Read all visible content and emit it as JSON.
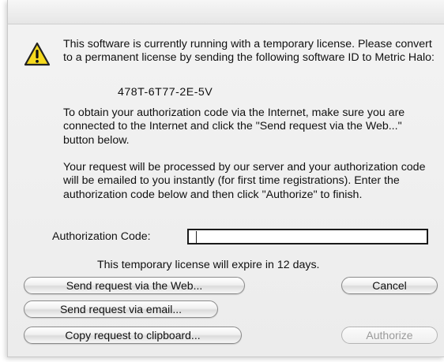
{
  "dialog": {
    "paragraph1": "This software is currently running with a temporary license. Please convert to a permanent license by sending the following software ID to Metric Halo:",
    "software_id": "478T-6T77-2E-5V",
    "paragraph2": "To obtain your authorization code via the Internet, make sure you are connected to the Internet and click the \"Send request via the Web...\" button below.",
    "paragraph3": "Your request will be processed by our  server and your authorization code will be emailed to you instantly (for first time registrations). Enter the authorization code below and then click \"Authorize\" to finish.",
    "auth_label": "Authorization Code:",
    "auth_value": "",
    "expire_notice": "This temporary license will expire in 12 days."
  },
  "buttons": {
    "send_web": "Send request via the Web...",
    "send_email": "Send request via email...",
    "copy_clipboard": "Copy request to clipboard...",
    "cancel": "Cancel",
    "authorize": "Authorize"
  },
  "icons": {
    "warning": "warning-icon"
  },
  "colors": {
    "warning_fill": "#f5d91e",
    "warning_stroke": "#222222"
  }
}
